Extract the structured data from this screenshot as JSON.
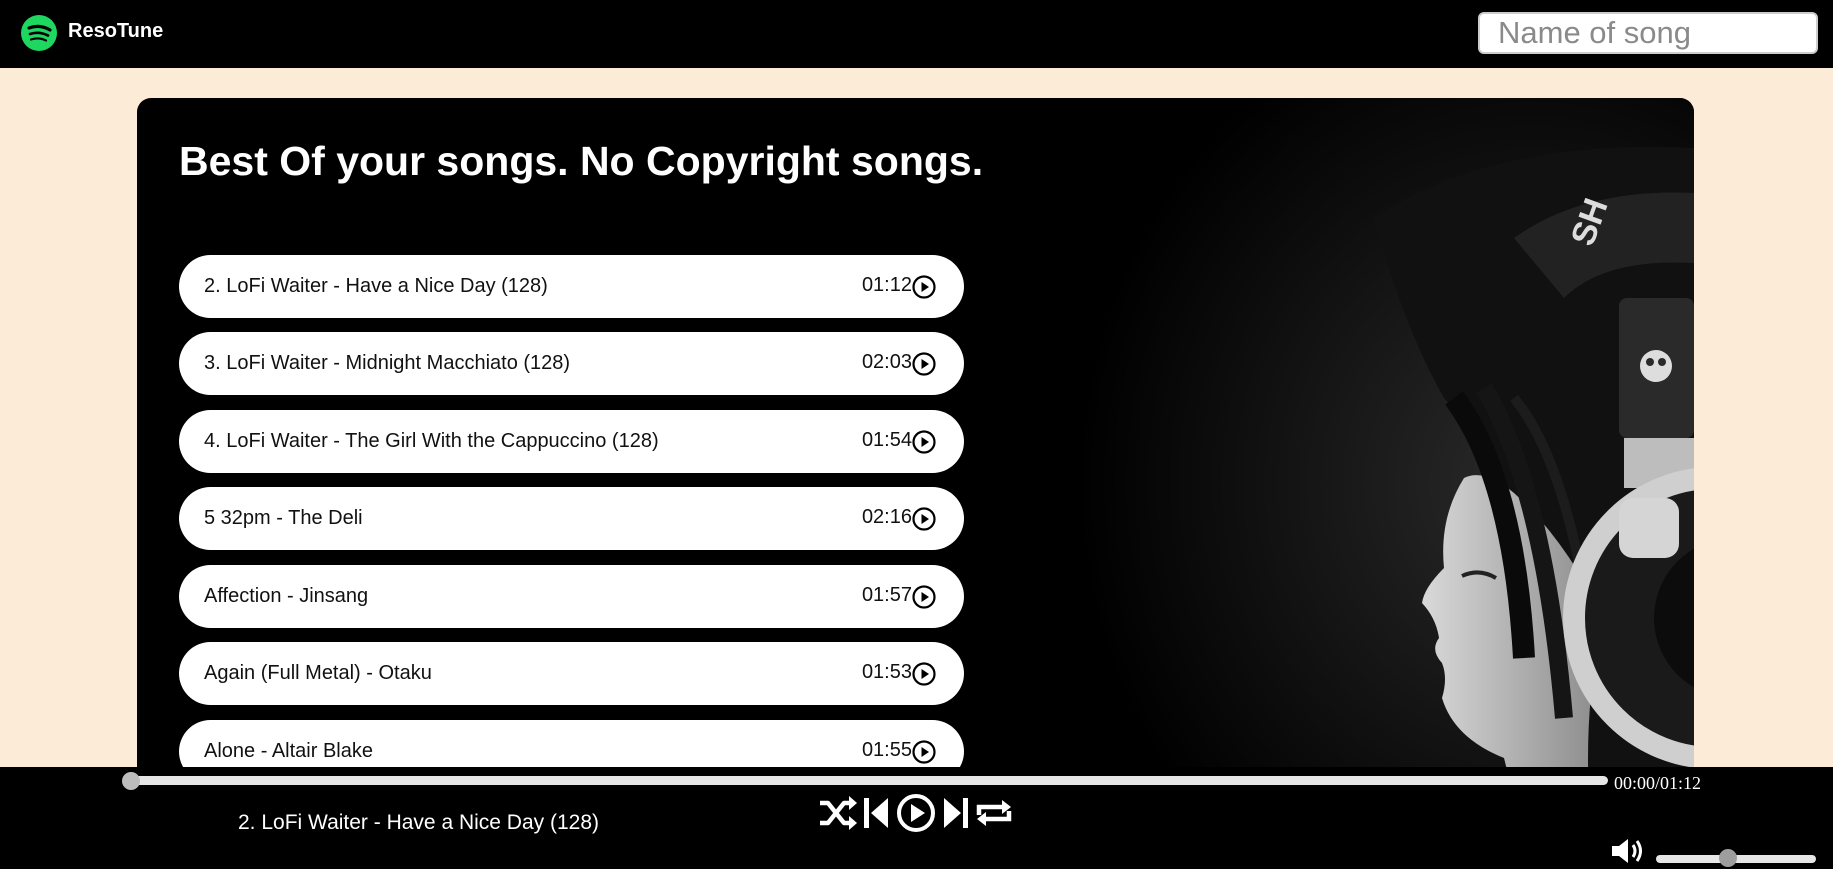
{
  "nav": {
    "brand": "ResoTune",
    "search_placeholder": "Name of song"
  },
  "main": {
    "heading": "Best Of your songs. No Copyright songs.",
    "songs": [
      {
        "title": "2. LoFi Waiter - Have a Nice Day (128)",
        "duration": "01:12"
      },
      {
        "title": "3. LoFi Waiter - Midnight Macchiato (128)",
        "duration": "02:03"
      },
      {
        "title": "4. LoFi Waiter - The Girl With the Cappuccino (128)",
        "duration": "01:54"
      },
      {
        "title": "5 32pm - The Deli",
        "duration": "02:16"
      },
      {
        "title": "Affection - Jinsang",
        "duration": "01:57"
      },
      {
        "title": "Again (Full Metal) - Otaku",
        "duration": "01:53"
      },
      {
        "title": "Alone - Altair Blake",
        "duration": "01:55"
      }
    ]
  },
  "player": {
    "time": "00:00/01:12",
    "now_playing": "2. LoFi Waiter - Have a Nice Day (128)",
    "progress": 0,
    "volume": 0.45
  },
  "icons": {
    "logo": "spotify-logo-icon",
    "play": "play-circle-icon",
    "shuffle": "shuffle-icon",
    "previous": "previous-icon",
    "next": "next-icon",
    "repeat": "repeat-icon",
    "volume": "volume-icon"
  },
  "colors": {
    "background": "#fbebd7",
    "accent": "#1ed760",
    "panel": "#000000"
  }
}
